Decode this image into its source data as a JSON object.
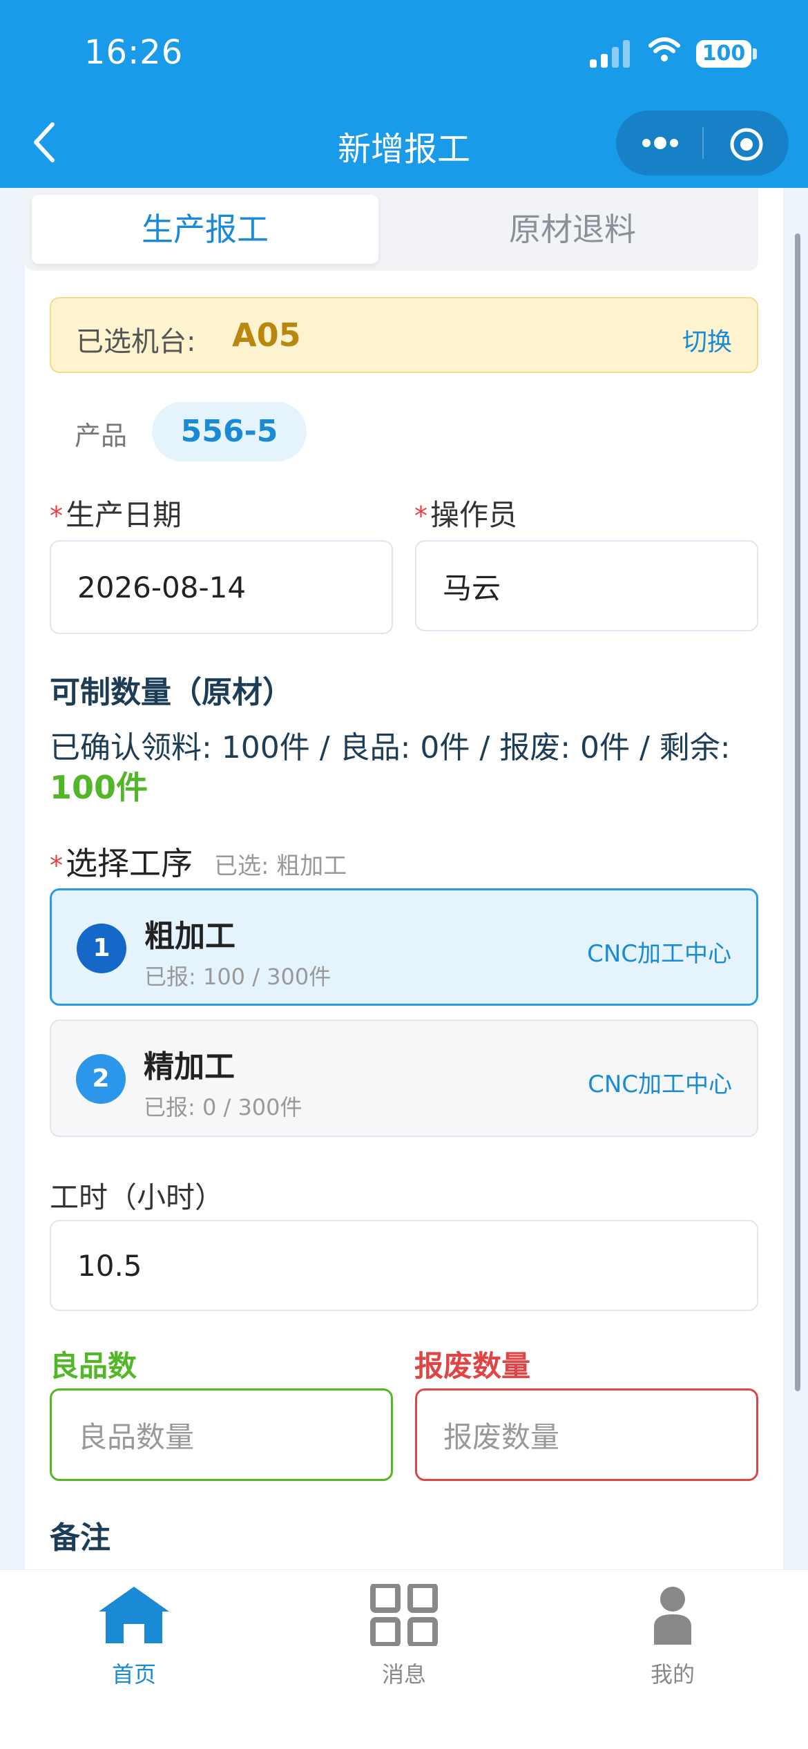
{
  "status_bar": {
    "time": "16:26",
    "battery": "100"
  },
  "nav": {
    "title": "新增报工"
  },
  "tabs": [
    {
      "label": "生产报工",
      "active": true
    },
    {
      "label": "原材退料",
      "active": false
    }
  ],
  "machine": {
    "label": "已选机台:",
    "value": "A05",
    "switch_label": "切换"
  },
  "product": {
    "label": "产品",
    "value": "556-5"
  },
  "production_date": {
    "required_mark": "*",
    "label": "生产日期",
    "value": "2026-08-14"
  },
  "operator": {
    "required_mark": "*",
    "label": "操作员",
    "value": "马云"
  },
  "available": {
    "title": "可制数量（原材）",
    "summary": "已确认领料: 100件 / 良品: 0件 / 报废: 0件 / 剩余:",
    "remaining": "100件"
  },
  "process": {
    "required_mark": "*",
    "label": "选择工序",
    "selected_text": "已选: 粗加工",
    "items": [
      {
        "num": "1",
        "name": "粗加工",
        "reported": "已报: 100 / 300件",
        "center": "CNC加工中心",
        "selected": true
      },
      {
        "num": "2",
        "name": "精加工",
        "reported": "已报: 0 / 300件",
        "center": "CNC加工中心",
        "selected": false
      }
    ]
  },
  "hours": {
    "label": "工时（小时）",
    "value": "10.5"
  },
  "good": {
    "label": "良品数",
    "placeholder": "良品数量",
    "color": "#52b726"
  },
  "scrap": {
    "label": "报废数量",
    "placeholder": "报废数量",
    "color": "#e04545"
  },
  "remark": {
    "label": "备注"
  },
  "bottom_nav": [
    {
      "label": "首页",
      "icon": "home-icon",
      "active": true
    },
    {
      "label": "消息",
      "icon": "grid-icon",
      "active": false
    },
    {
      "label": "我的",
      "icon": "user-icon",
      "active": false
    }
  ],
  "colors": {
    "primary": "#1a9be9",
    "accent": "#1a8ad6",
    "success": "#52b726",
    "danger": "#e04545"
  }
}
